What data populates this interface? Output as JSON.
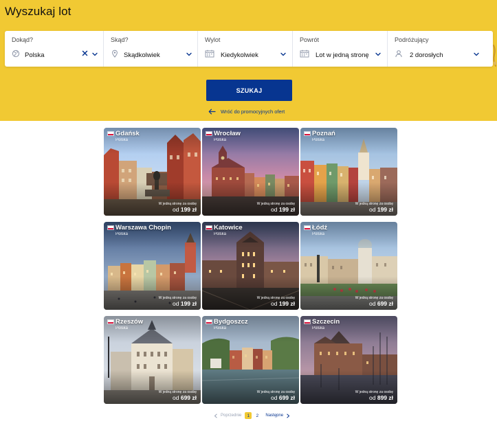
{
  "page": {
    "title": "Wyszukaj lot"
  },
  "colors": {
    "accent": "#f1c933",
    "primary": "#073590",
    "flag_red": "#dc143c"
  },
  "search": {
    "fields": [
      {
        "label": "Dokąd?",
        "value": "Polska",
        "icon": "globe-icon",
        "has_clear": true
      },
      {
        "label": "Skąd?",
        "value": "Skądkolwiek",
        "icon": "map-pin-icon",
        "has_clear": false
      },
      {
        "label": "Wylot",
        "value": "Kiedykolwiek",
        "icon": "calendar-icon",
        "has_clear": false
      },
      {
        "label": "Powrót",
        "value": "Lot w jedną stronę",
        "icon": "calendar-icon",
        "has_clear": false
      },
      {
        "label": "Podróżujący",
        "value": "2 dorosłych",
        "icon": "person-icon",
        "has_clear": false
      }
    ],
    "submit_label": "SZUKAJ",
    "back_link": "Wróć do promocyjnych ofert"
  },
  "destinations": [
    {
      "city": "Gdańsk",
      "country": "Polska",
      "price_note": "W jedną stronę za osobę",
      "price_from": "od",
      "price": "199 zł"
    },
    {
      "city": "Wrocław",
      "country": "Polska",
      "price_note": "W jedną stronę za osobę",
      "price_from": "od",
      "price": "199 zł"
    },
    {
      "city": "Poznań",
      "country": "Polska",
      "price_note": "W jedną stronę za osobę",
      "price_from": "od",
      "price": "199 zł"
    },
    {
      "city": "Warszawa Chopin",
      "country": "Polska",
      "price_note": "W jedną stronę za osobę",
      "price_from": "od",
      "price": "199 zł"
    },
    {
      "city": "Katowice",
      "country": "Polska",
      "price_note": "W jedną stronę za osobę",
      "price_from": "od",
      "price": "199 zł"
    },
    {
      "city": "Łódź",
      "country": "Polska",
      "price_note": "W jedną stronę za osobę",
      "price_from": "od",
      "price": "699 zł"
    },
    {
      "city": "Rzeszów",
      "country": "Polska",
      "price_note": "W jedną stronę za osobę",
      "price_from": "od",
      "price": "699 zł"
    },
    {
      "city": "Bydgoszcz",
      "country": "Polska",
      "price_note": "W jedną stronę za osobę",
      "price_from": "od",
      "price": "699 zł"
    },
    {
      "city": "Szczecin",
      "country": "Polska",
      "price_note": "W jedną stronę za osobę",
      "price_from": "od",
      "price": "899 zł"
    }
  ],
  "pagination": {
    "prev_label": "Poprzednie",
    "pages": [
      "1",
      "2"
    ],
    "current": "1",
    "next_label": "Następne"
  }
}
